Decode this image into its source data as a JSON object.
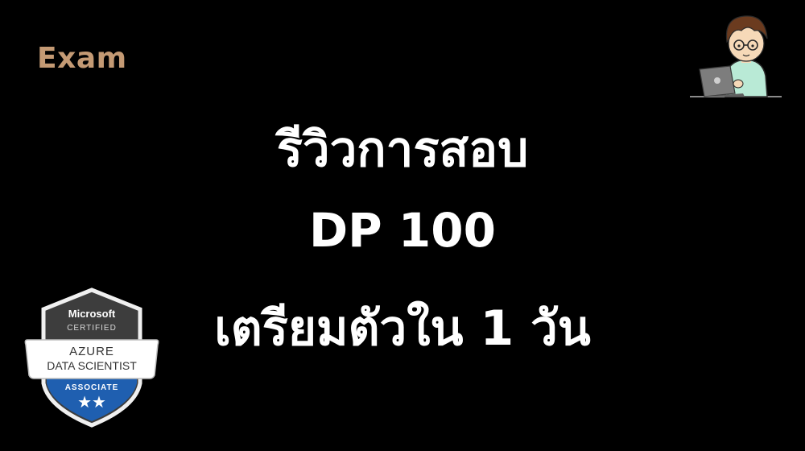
{
  "category_label": "Exam",
  "headline": {
    "line1": "รีวิวการสอบ",
    "line2": "DP 100",
    "line3": "เตรียมตัวใน 1 วัน"
  },
  "badge": {
    "brand": "Microsoft",
    "certified": "CERTIFIED",
    "title_line1": "AZURE",
    "title_line2": "DATA SCIENTIST",
    "level": "ASSOCIATE",
    "stars": "★★"
  },
  "colors": {
    "background": "#000000",
    "category_accent": "#c49a74",
    "headline": "#ffffff",
    "badge_dark": "#4a4a4a",
    "badge_blue": "#1f5fb0"
  },
  "icons": {
    "avatar": "cartoon-person-with-laptop-icon"
  }
}
